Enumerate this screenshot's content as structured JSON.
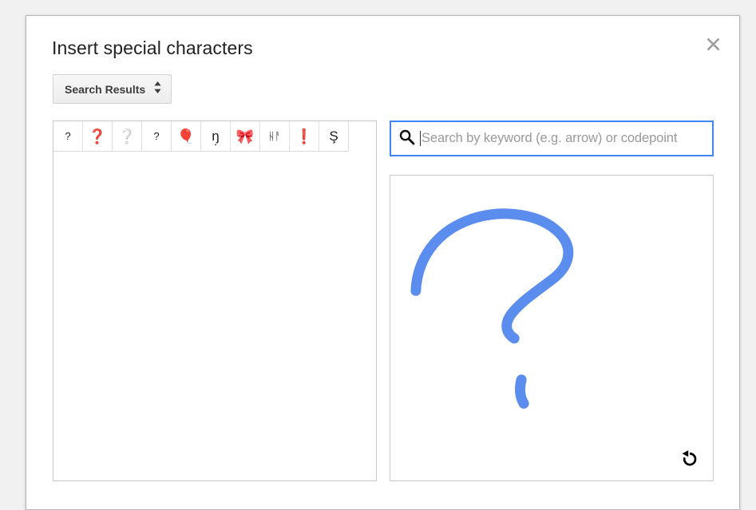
{
  "dialog": {
    "title": "Insert special characters",
    "close_label": "Close",
    "close_icon": "close-icon"
  },
  "category": {
    "selected": "Search Results",
    "icon": "up-down-chevron-icon"
  },
  "results": {
    "panel_label": "Search results grid",
    "characters": [
      {
        "glyph": "?",
        "name": "question-mark",
        "style": "small"
      },
      {
        "glyph": "❓",
        "name": "red-question-mark-ornament",
        "style": "emoji"
      },
      {
        "glyph": "❔",
        "name": "white-question-mark-ornament",
        "style": "emoji"
      },
      {
        "glyph": "?",
        "name": "small-question-mark",
        "style": "small"
      },
      {
        "glyph": "🎈",
        "name": "balloon-emoji",
        "style": "emoji"
      },
      {
        "glyph": "ŋ̣",
        "name": "eng-with-dot-below",
        "style": "normal"
      },
      {
        "glyph": "🎀",
        "name": "ribbon-emoji",
        "style": "emoji"
      },
      {
        "glyph": "ᚺᚨ",
        "name": "ha-ligature-glyph",
        "style": "small"
      },
      {
        "glyph": "❗",
        "name": "red-exclamation-mark-ornament",
        "style": "emoji"
      },
      {
        "glyph": "Ş",
        "name": "s-with-cedilla",
        "style": "normal"
      }
    ]
  },
  "search": {
    "placeholder": "Search by keyword (e.g. arrow) or codepoint",
    "value": "",
    "icon": "search-icon",
    "focus_color": "#4285f4"
  },
  "draw": {
    "panel_label": "Draw a character here",
    "stroke_color": "#5b8def",
    "undo_label": "Clear drawing",
    "undo_icon": "undo-icon"
  }
}
